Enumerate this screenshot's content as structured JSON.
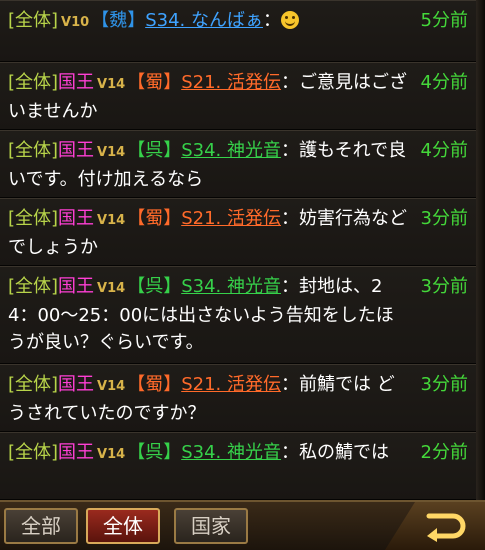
{
  "messages": [
    {
      "channel": "[全体]",
      "rank": "",
      "vip": "V10",
      "kingdom": "【魏】",
      "name": "S34. なんばぁ",
      "text": "：",
      "emoji": "smiley-icon",
      "time": "5分前"
    },
    {
      "channel": "[全体]",
      "rank": "国王",
      "vip": "V14",
      "kingdom": "【蜀】",
      "name": "S21. 活発伝",
      "text": "：ご意見はございませんか",
      "time": "4分前"
    },
    {
      "channel": "[全体]",
      "rank": "国王",
      "vip": "V14",
      "kingdom": "【呉】",
      "name": "S34. 神光音",
      "text": "：護もそれで良いです。付け加えるなら",
      "time": "4分前"
    },
    {
      "channel": "[全体]",
      "rank": "国王",
      "vip": "V14",
      "kingdom": "【蜀】",
      "name": "S21. 活発伝",
      "text": "：妨害行為などでしょうか",
      "time": "3分前"
    },
    {
      "channel": "[全体]",
      "rank": "国王",
      "vip": "V14",
      "kingdom": "【呉】",
      "name": "S34. 神光音",
      "text": "：封地は、24：00～25：00には出さないよう告知をしたほうが良い？ぐらいです。",
      "time": "3分前"
    },
    {
      "channel": "[全体]",
      "rank": "国王",
      "vip": "V14",
      "kingdom": "【蜀】",
      "name": "S21. 活発伝",
      "text": "：前鯖では どうされていたのですか？",
      "time": "3分前"
    },
    {
      "channel": "[全体]",
      "rank": "国王",
      "vip": "V14",
      "kingdom": "【呉】",
      "name": "S34. 神光音",
      "text": "：私の鯖では",
      "time": "2分前"
    }
  ],
  "tabs": [
    {
      "label": "全部",
      "active": false
    },
    {
      "label": "全体",
      "active": true
    },
    {
      "label": "国家",
      "active": false
    }
  ],
  "back_icon": "return-arrow-icon",
  "colors": {
    "channel": "#b8d44a",
    "rank": "#ff3fd5",
    "shu": "#ff6a2a",
    "wu": "#36d14a",
    "wei": "#2f93e8",
    "time": "#44d83a"
  }
}
